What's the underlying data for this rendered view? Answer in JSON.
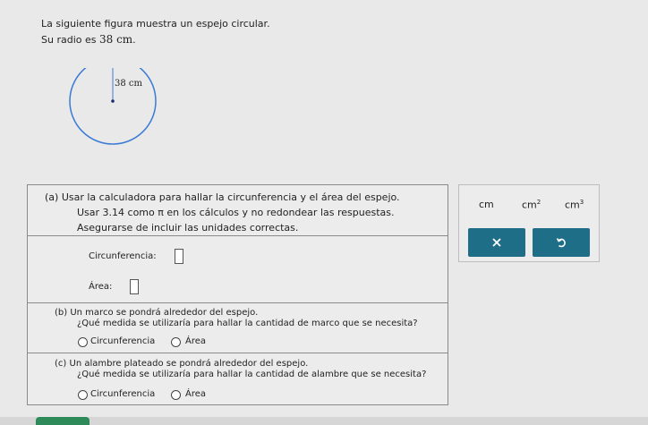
{
  "problem": {
    "intro_line1": "La siguiente figura muestra un espejo circular.",
    "intro_line2_prefix": "Su radio es ",
    "radius_value": "38 cm",
    "intro_line2_suffix": ".",
    "figure_label": "38 cm"
  },
  "part_a": {
    "marker": "(a)",
    "line1": "Usar la calculadora para hallar la circunferencia y el área del espejo.",
    "line2": "Usar 3.14 como π en los cálculos y no redondear las respuestas.",
    "line3": "Asegurarse de incluir las unidades correctas.",
    "circ_label": "Circunferencia:",
    "area_label": "Área:"
  },
  "part_b": {
    "marker": "(b)",
    "line1": "Un marco se pondrá alrededor del espejo.",
    "line2": "¿Qué medida se utilizaría para hallar la cantidad de marco que se necesita?",
    "option1": "Circunferencia",
    "option2": "Área"
  },
  "part_c": {
    "marker": "(c)",
    "line1": "Un alambre plateado se pondrá alrededor del espejo.",
    "line2": "¿Qué medida se utilizaría para hallar la cantidad de alambre que se necesita?",
    "option1": "Circunferencia",
    "option2": "Área"
  },
  "units": {
    "u1": "cm",
    "u2_base": "cm",
    "u2_exp": "2",
    "u3_base": "cm",
    "u3_exp": "3"
  },
  "colors": {
    "button": "#1f6e88",
    "circle": "#3a7bd5"
  }
}
